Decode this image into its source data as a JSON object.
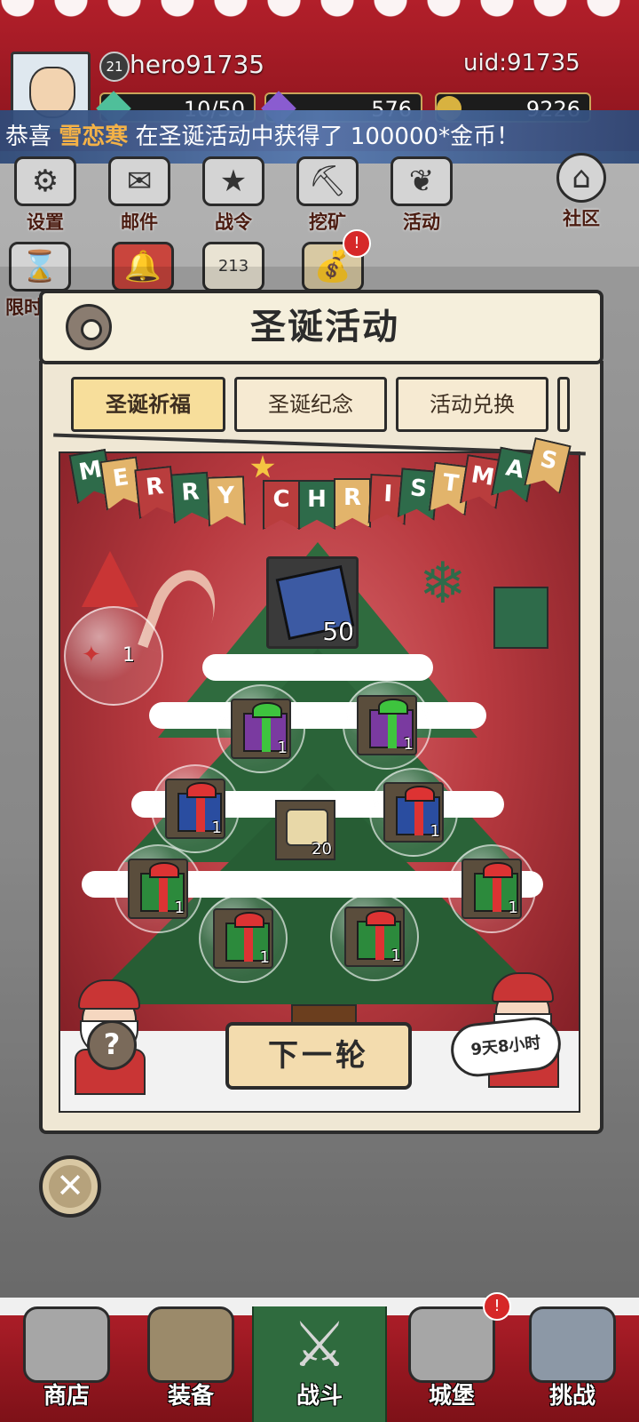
{
  "profile": {
    "level": "21",
    "name": "hero91735",
    "uid": "uid:91735"
  },
  "resources": [
    {
      "icon": "gem-icon",
      "value": "10/50"
    },
    {
      "icon": "diamond-icon",
      "value": "576"
    },
    {
      "icon": "gold-coin-icon",
      "value": "9226"
    }
  ],
  "announcement": {
    "prefix": "恭喜 ",
    "player": "雪恋寒",
    "suffix": " 在圣诞活动中获得了 100000*金币！"
  },
  "top_buttons": [
    {
      "name": "settings",
      "label": "设置",
      "icon": "gear-icon"
    },
    {
      "name": "mail",
      "label": "邮件",
      "icon": "envelope-icon"
    },
    {
      "name": "battle-pass",
      "label": "战令",
      "icon": "badge-icon"
    },
    {
      "name": "mining",
      "label": "挖矿",
      "icon": "pickaxe-icon"
    },
    {
      "name": "activity",
      "label": "活动",
      "icon": "laurel-icon"
    },
    {
      "name": "community",
      "label": "社区",
      "icon": "house-icon"
    }
  ],
  "second_row": [
    {
      "name": "limited",
      "label": "限时",
      "icon": "hourglass-icon"
    },
    {
      "name": "christmas",
      "label": "",
      "icon": "christmas-bell-icon"
    },
    {
      "name": "lottery",
      "label": "",
      "icon": "number-card-icon"
    },
    {
      "name": "bag",
      "label": "",
      "icon": "sack-icon",
      "badge": "!"
    }
  ],
  "modal": {
    "title": "圣诞活动",
    "tabs": [
      {
        "label": "圣诞祈福",
        "active": true
      },
      {
        "label": "圣诞纪念",
        "active": false
      },
      {
        "label": "活动兑换",
        "active": false
      }
    ],
    "banner_letters": [
      "M",
      "E",
      "R",
      "R",
      "Y",
      "C",
      "H",
      "R",
      "I",
      "S",
      "T",
      "M",
      "A",
      "S"
    ],
    "candy_count": "1",
    "center_rewards": [
      {
        "name": "book-reward",
        "count": "50"
      },
      {
        "name": "scroll-reward",
        "count": "20"
      }
    ],
    "gift_rewards": [
      {
        "color": "purple",
        "count": "1"
      },
      {
        "color": "purple",
        "count": "1"
      },
      {
        "color": "blue",
        "count": "1"
      },
      {
        "color": "blue",
        "count": "1"
      },
      {
        "color": "green",
        "count": "1"
      },
      {
        "color": "green",
        "count": "1"
      },
      {
        "color": "green",
        "count": "1"
      },
      {
        "color": "green",
        "count": "1"
      }
    ],
    "next_round_label": "下一轮",
    "help_label": "?",
    "timer": "9天8小时"
  },
  "close_label": "✕",
  "bottom_nav": [
    {
      "name": "shop",
      "label": "商店",
      "active": false
    },
    {
      "name": "equipment",
      "label": "装备",
      "active": false
    },
    {
      "name": "battle",
      "label": "战斗",
      "active": true
    },
    {
      "name": "castle",
      "label": "城堡",
      "active": false,
      "badge": "!"
    },
    {
      "name": "challenge",
      "label": "挑战",
      "active": false
    }
  ],
  "colors": {
    "header_red": "#b21f2a",
    "tree_green": "#2f6b3e",
    "announce_highlight": "#f4b247"
  }
}
